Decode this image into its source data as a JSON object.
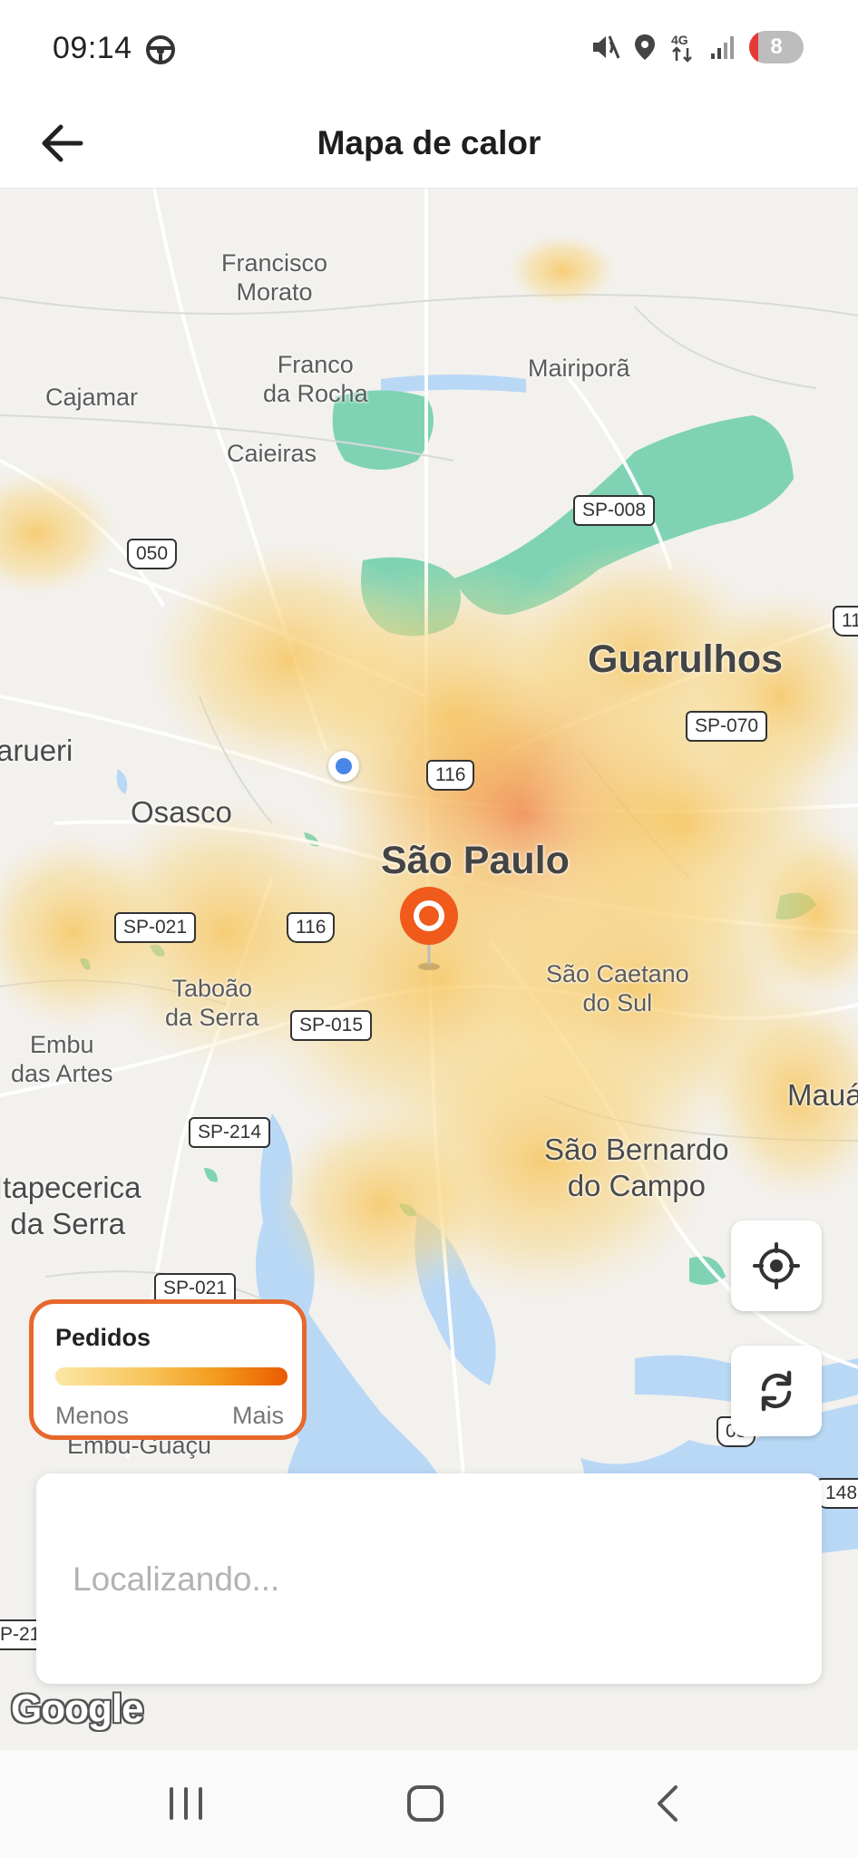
{
  "status_bar": {
    "time": "09:14",
    "left_icon": "steering-wheel-icon",
    "right_icons": [
      "mute-icon",
      "location-icon",
      "4g-data-icon",
      "signal-icon"
    ],
    "battery_count": "8"
  },
  "app_bar": {
    "title": "Mapa de calor",
    "back_icon": "arrow-left-icon"
  },
  "map": {
    "places": {
      "francisco_morato": "Francisco\nMorato",
      "cajamar": "Cajamar",
      "franco_da_rocha": "Franco\nda Rocha",
      "mairipora": "Mairiporã",
      "caieiras": "Caieiras",
      "guarulhos": "Guarulhos",
      "barueri": "arueri",
      "osasco": "Osasco",
      "sao_paulo": "São Paulo",
      "taboao": "Taboão\nda Serra",
      "sao_caetano": "São Caetano\ndo Sul",
      "embu": "Embu\ndas Artes",
      "maua": "Mauá",
      "itapecerica": "Itapecerica\nda Serra",
      "sao_bernardo": "São Bernardo\ndo Campo",
      "embu_guacu": "Embu-Guaçu"
    },
    "shields": {
      "sp008": "SP-008",
      "r050": "050",
      "r11": "11",
      "sp070": "SP-070",
      "r116a": "116",
      "sp021a": "SP-021",
      "r116b": "116",
      "sp015": "SP-015",
      "sp214": "SP-214",
      "sp021b": "SP-021",
      "r03": "03",
      "r148": "148",
      "sp21": "P-21"
    }
  },
  "legend": {
    "title": "Pedidos",
    "min_label": "Menos",
    "max_label": "Mais",
    "colors": [
      "#fbe7a6",
      "#f8c45a",
      "#f39a1c",
      "#ea5a00"
    ]
  },
  "buttons": {
    "locate_icon": "crosshair-icon",
    "refresh_icon": "refresh-icon"
  },
  "location_card": {
    "status_text": "Localizando..."
  },
  "attribution": "Google",
  "nav_bar": {
    "recents_icon": "recents-icon",
    "home_icon": "home-icon",
    "back_icon": "chevron-left-icon"
  },
  "colors": {
    "accent": "#e8672a",
    "pin": "#f05a1a",
    "park": "#7fd3b4",
    "water": "#b9d8f5"
  }
}
